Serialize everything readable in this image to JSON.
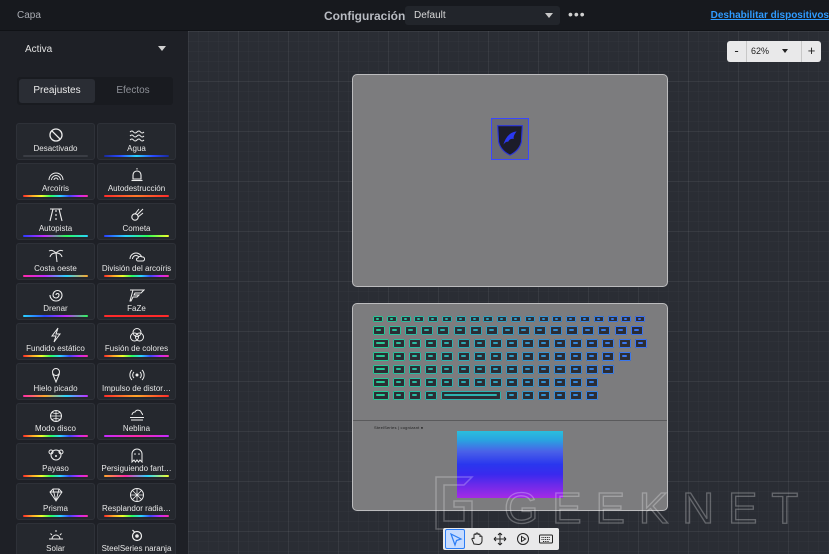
{
  "topbar": {
    "layer_label": "Capa",
    "config_label": "Configuración:",
    "config_value": "Default",
    "more_label": "•••",
    "disable_devices_link": "Deshabilitar dispositivos"
  },
  "sidebar": {
    "active_select": "Activa",
    "tabs": [
      {
        "label": "Preajustes",
        "selected": true
      },
      {
        "label": "Efectos",
        "selected": false
      }
    ],
    "presets": [
      {
        "label": "Desactivado",
        "icon": "prohibited-icon"
      },
      {
        "label": "Agua",
        "icon": "waves-icon"
      },
      {
        "label": "Arcoíris",
        "icon": "rainbow-icon"
      },
      {
        "label": "Autodestrucción",
        "icon": "siren-icon"
      },
      {
        "label": "Autopista",
        "icon": "road-icon"
      },
      {
        "label": "Cometa",
        "icon": "comet-icon"
      },
      {
        "label": "Costa oeste",
        "icon": "palm-tree-icon"
      },
      {
        "label": "División del arcoíris",
        "icon": "rainbow-cloud-icon"
      },
      {
        "label": "Drenar",
        "icon": "spiral-icon"
      },
      {
        "label": "FaZe",
        "icon": "faze-logo-icon"
      },
      {
        "label": "Fundido estático",
        "icon": "lightning-icon"
      },
      {
        "label": "Fusión de colores",
        "icon": "color-blend-icon"
      },
      {
        "label": "Hielo picado",
        "icon": "ice-cream-icon"
      },
      {
        "label": "Impulso de distor…",
        "icon": "broadcast-icon"
      },
      {
        "label": "Modo disco",
        "icon": "disco-ball-icon"
      },
      {
        "label": "Neblina",
        "icon": "fog-icon"
      },
      {
        "label": "Payaso",
        "icon": "clown-icon"
      },
      {
        "label": "Persiguiendo fant…",
        "icon": "ghost-icon"
      },
      {
        "label": "Prisma",
        "icon": "prism-icon"
      },
      {
        "label": "Resplandor radia…",
        "icon": "radial-glow-icon"
      },
      {
        "label": "Solar",
        "icon": "sunrise-icon"
      },
      {
        "label": "SteelSeries naranja",
        "icon": "steelseries-icon"
      }
    ]
  },
  "canvas": {
    "zoom": {
      "minus": "-",
      "value": "62%",
      "plus": "+"
    },
    "keyboard_brand_text": "SteelSeries | cognizant ●",
    "watermark_text": "GEEKNETIC",
    "tools": [
      {
        "name": "select-tool",
        "selected": true
      },
      {
        "name": "pan-tool",
        "selected": false
      },
      {
        "name": "move-tool",
        "selected": false
      },
      {
        "name": "play-tool",
        "selected": false
      },
      {
        "name": "keyboard-tool",
        "selected": false
      }
    ]
  },
  "colors": {
    "accent_link": "#2f9bff",
    "selection_blue": "#3a47ff",
    "touchpad_top": "#2abedc",
    "touchpad_bottom": "#a42ae6"
  }
}
